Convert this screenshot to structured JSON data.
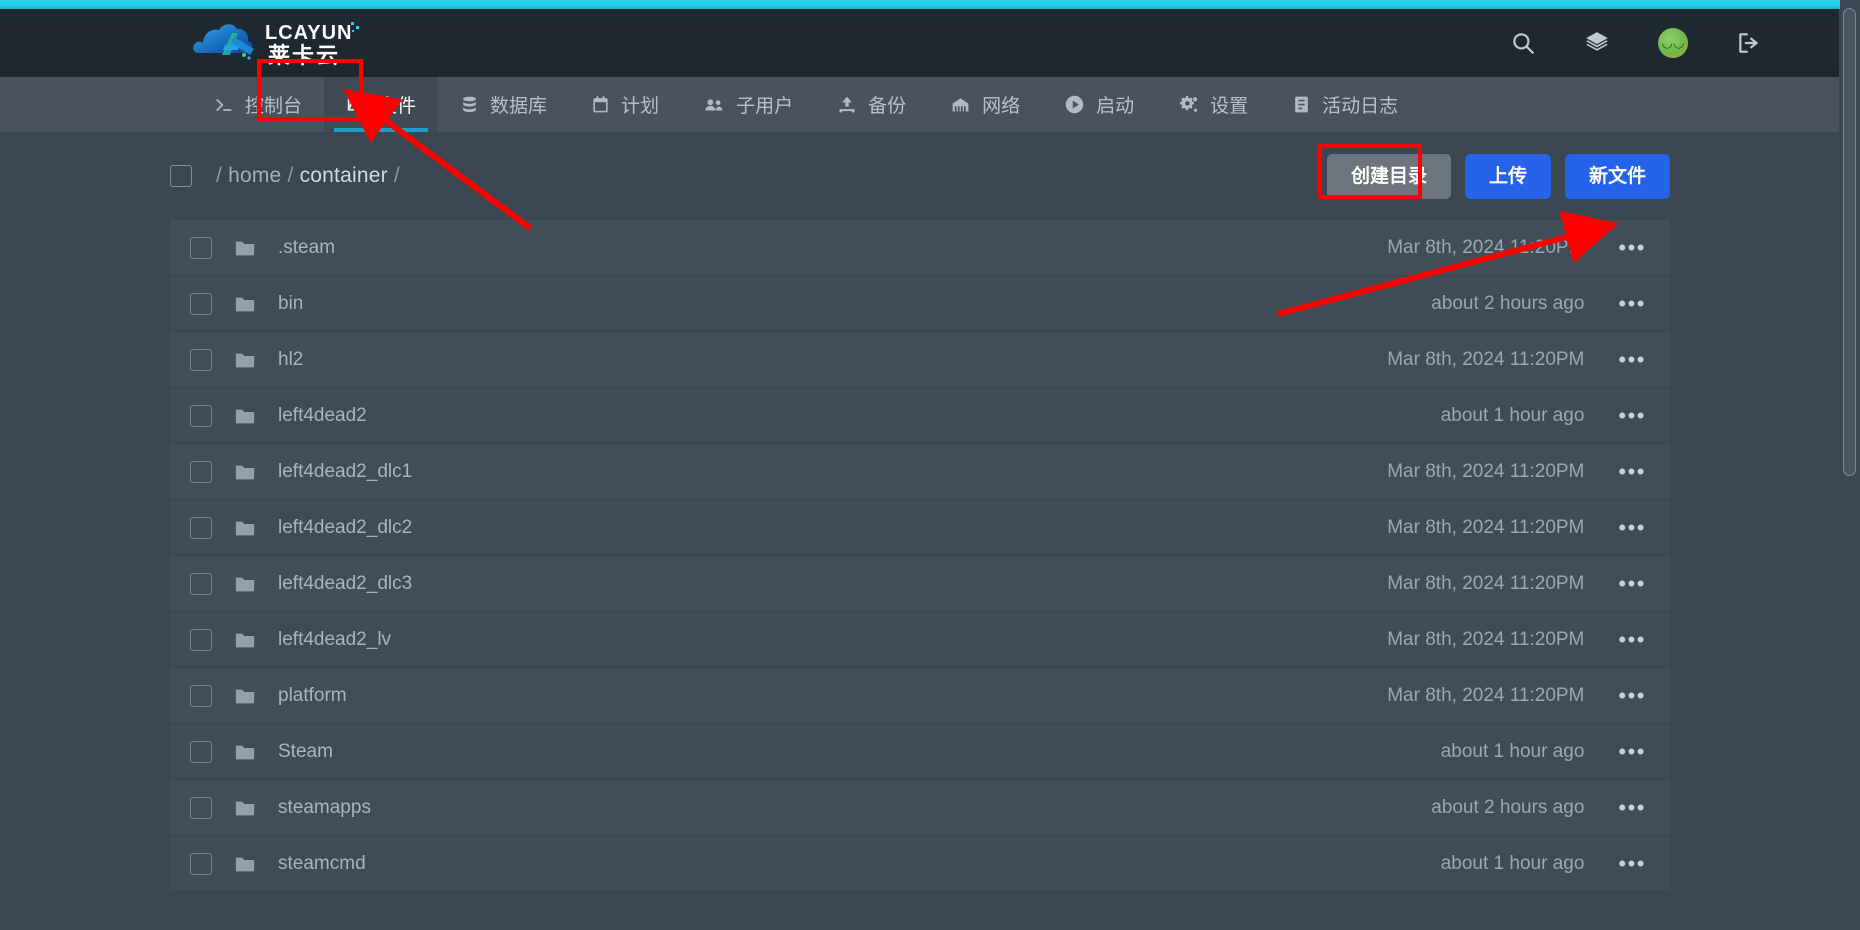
{
  "brand": {
    "logo_text_en": "LCAYUN",
    "logo_text_cn": "莱卡云"
  },
  "header": {
    "icons": [
      {
        "name": "search-icon",
        "label": "搜索"
      },
      {
        "name": "layers-icon",
        "label": "服务器切换"
      },
      {
        "name": "avatar",
        "label": "账户"
      },
      {
        "name": "logout-icon",
        "label": "退出"
      }
    ]
  },
  "nav": {
    "tabs": [
      {
        "label": "控制台",
        "icon": "console-icon",
        "active": false
      },
      {
        "label": "文件",
        "icon": "folder-icon",
        "active": true
      },
      {
        "label": "数据库",
        "icon": "database-icon",
        "active": false
      },
      {
        "label": "计划",
        "icon": "calendar-icon",
        "active": false
      },
      {
        "label": "子用户",
        "icon": "users-icon",
        "active": false
      },
      {
        "label": "备份",
        "icon": "upload-icon",
        "active": false
      },
      {
        "label": "网络",
        "icon": "network-icon",
        "active": false
      },
      {
        "label": "启动",
        "icon": "play-icon",
        "active": false
      },
      {
        "label": "设置",
        "icon": "gear-icon",
        "active": false
      },
      {
        "label": "活动日志",
        "icon": "log-icon",
        "active": false
      }
    ]
  },
  "toolbar": {
    "breadcrumb": {
      "leading_separator": "/",
      "segments": [
        "home",
        "container"
      ],
      "trailing_separator": "/"
    },
    "create_dir_label": "创建目录",
    "upload_label": "上传",
    "new_file_label": "新文件",
    "accent_blue": "#2563eb",
    "grey_button": "#6b757e"
  },
  "files": {
    "row_menu_glyph": "•••",
    "items": [
      {
        "name": ".steam",
        "type": "folder",
        "modified": "Mar 8th, 2024 11:20PM"
      },
      {
        "name": "bin",
        "type": "folder",
        "modified": "about 2 hours ago"
      },
      {
        "name": "hl2",
        "type": "folder",
        "modified": "Mar 8th, 2024 11:20PM"
      },
      {
        "name": "left4dead2",
        "type": "folder",
        "modified": "about 1 hour ago"
      },
      {
        "name": "left4dead2_dlc1",
        "type": "folder",
        "modified": "Mar 8th, 2024 11:20PM"
      },
      {
        "name": "left4dead2_dlc2",
        "type": "folder",
        "modified": "Mar 8th, 2024 11:20PM"
      },
      {
        "name": "left4dead2_dlc3",
        "type": "folder",
        "modified": "Mar 8th, 2024 11:20PM"
      },
      {
        "name": "left4dead2_lv",
        "type": "folder",
        "modified": "Mar 8th, 2024 11:20PM"
      },
      {
        "name": "platform",
        "type": "folder",
        "modified": "Mar 8th, 2024 11:20PM"
      },
      {
        "name": "Steam",
        "type": "folder",
        "modified": "about 1 hour ago"
      },
      {
        "name": "steamapps",
        "type": "folder",
        "modified": "about 2 hours ago"
      },
      {
        "name": "steamcmd",
        "type": "folder",
        "modified": "about 1 hour ago"
      }
    ]
  },
  "annotations": {
    "color": "#ff0000",
    "highlight_tab": "文件",
    "highlight_button": "新文件"
  }
}
